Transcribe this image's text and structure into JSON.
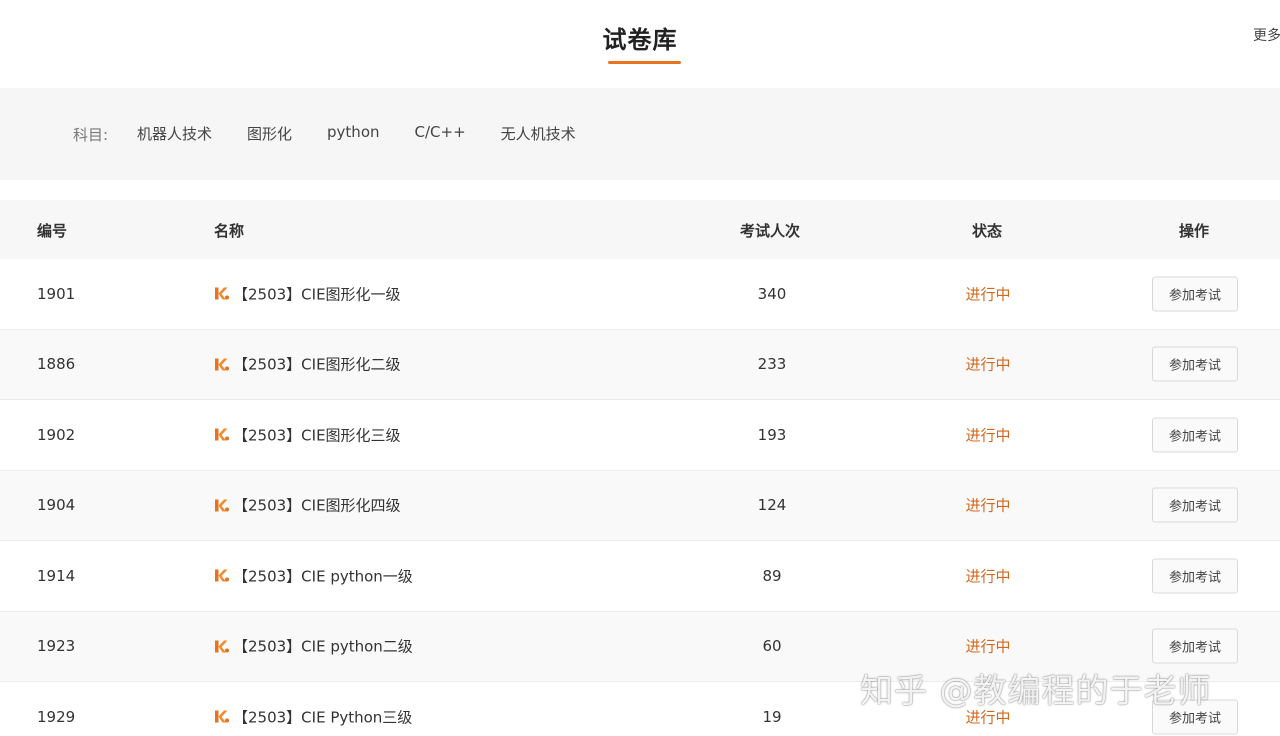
{
  "header": {
    "title": "试卷库",
    "more": "更多"
  },
  "filter": {
    "label": "科目:",
    "options": [
      "机器人技术",
      "图形化",
      "python",
      "C/C++",
      "无人机技术"
    ]
  },
  "table": {
    "columns": {
      "id": "编号",
      "name": "名称",
      "count": "考试人次",
      "status": "状态",
      "action": "操作"
    },
    "rows": [
      {
        "id": "1901",
        "name": "【2503】CIE图形化一级",
        "count": "340",
        "status": "进行中",
        "action": "参加考试"
      },
      {
        "id": "1886",
        "name": "【2503】CIE图形化二级",
        "count": "233",
        "status": "进行中",
        "action": "参加考试"
      },
      {
        "id": "1902",
        "name": "【2503】CIE图形化三级",
        "count": "193",
        "status": "进行中",
        "action": "参加考试"
      },
      {
        "id": "1904",
        "name": "【2503】CIE图形化四级",
        "count": "124",
        "status": "进行中",
        "action": "参加考试"
      },
      {
        "id": "1914",
        "name": "【2503】CIE python一级",
        "count": "89",
        "status": "进行中",
        "action": "参加考试"
      },
      {
        "id": "1923",
        "name": "【2503】CIE python二级",
        "count": "60",
        "status": "进行中",
        "action": "参加考试"
      },
      {
        "id": "1929",
        "name": "【2503】CIE Python三级",
        "count": "19",
        "status": "进行中",
        "action": "参加考试"
      }
    ]
  },
  "icons": {
    "row_icon": "kp-brand-icon"
  },
  "colors": {
    "accent": "#e8731f",
    "status": "#d2691e"
  },
  "watermark": "知乎 @教编程的于老师"
}
